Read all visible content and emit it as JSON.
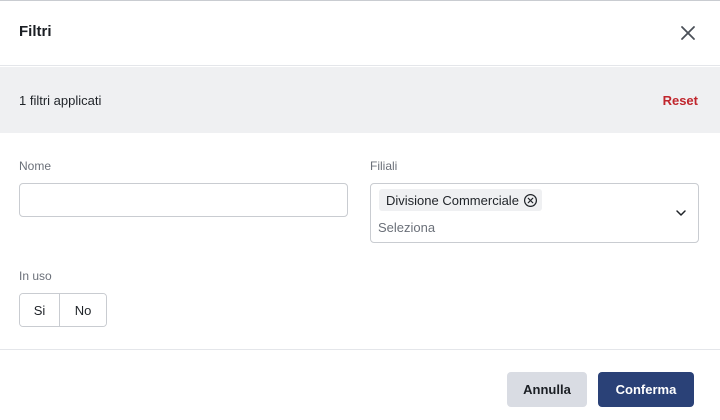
{
  "dialog": {
    "title": "Filtri",
    "close_icon": "close-icon"
  },
  "filter_bar": {
    "count_text": "1 filtri applicati",
    "reset_label": "Reset"
  },
  "form": {
    "nome": {
      "label": "Nome",
      "value": "",
      "placeholder": ""
    },
    "filiali": {
      "label": "Filiali",
      "selected": [
        {
          "label": "Divisione Commerciale",
          "remove_icon": "circle-x-icon"
        }
      ],
      "placeholder": "Seleziona",
      "chevron_icon": "chevron-down-icon"
    },
    "in_uso": {
      "label": "In uso",
      "options": [
        "Si",
        "No"
      ]
    }
  },
  "footer": {
    "cancel_label": "Annulla",
    "confirm_label": "Conferma"
  },
  "colors": {
    "accent": "#2a4177",
    "reset": "#c0262d",
    "filter_bar_bg": "#eff0f2",
    "cancel_bg": "#d9dce3"
  }
}
